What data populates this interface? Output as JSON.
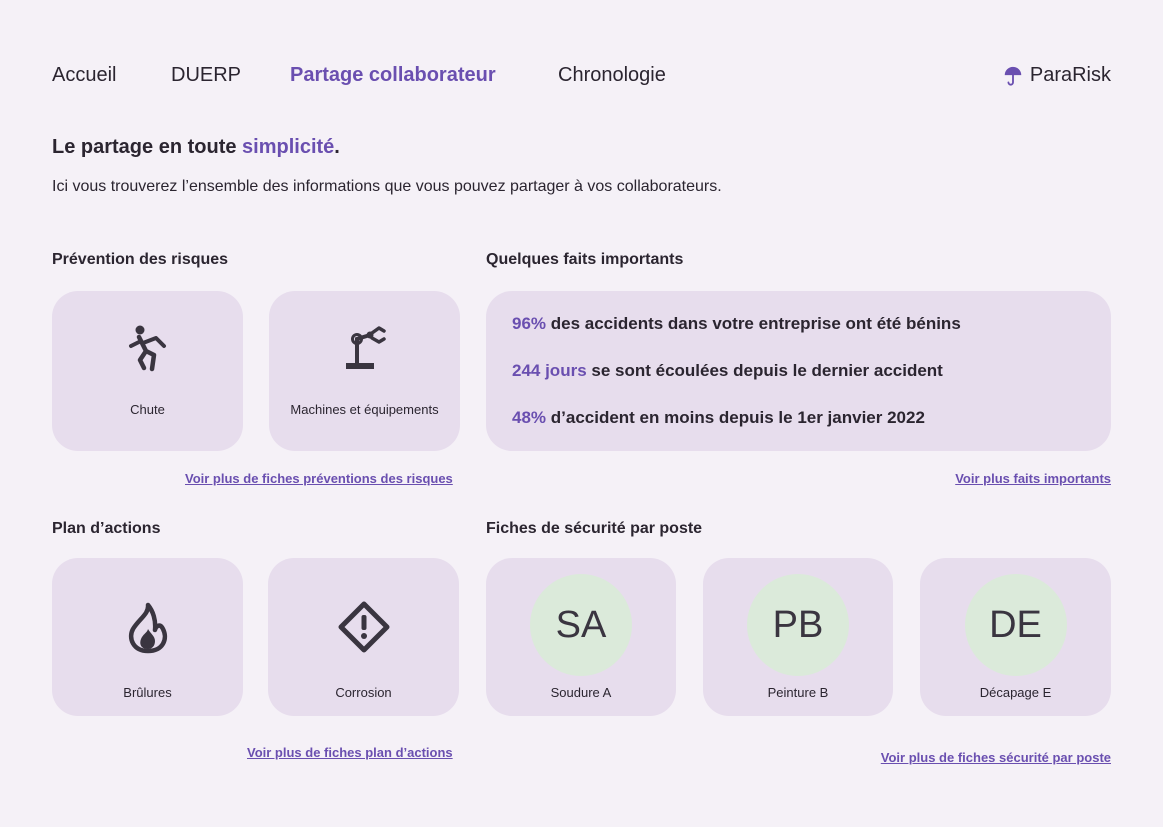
{
  "nav": {
    "items": [
      {
        "label": "Accueil"
      },
      {
        "label": "DUERP"
      },
      {
        "label": "Partage collaborateur"
      },
      {
        "label": "Chronologie"
      }
    ],
    "brand": "ParaRisk"
  },
  "headline": {
    "prefix": "Le partage en toute ",
    "accent": "simplicité",
    "suffix": "."
  },
  "intro": "Ici vous trouverez l’ensemble des informations que vous pouvez partager à vos collaborateurs.",
  "prevention": {
    "title": "Prévention des risques",
    "cards": [
      {
        "label": "Chute",
        "icon": "falling-person-icon"
      },
      {
        "label": "Machines et équipements",
        "icon": "robot-arm-icon"
      }
    ],
    "more": "Voir plus de fiches préventions des risques"
  },
  "facts": {
    "title": "Quelques faits importants",
    "items": [
      {
        "highlight": "96%",
        "text": " des accidents dans votre entreprise ont été bénins"
      },
      {
        "highlight": "244 jours",
        "text": " se sont écoulées depuis le dernier accident"
      },
      {
        "highlight": "48%",
        "text": " d’accident en moins depuis le 1er janvier 2022"
      }
    ],
    "more": "Voir plus faits importants"
  },
  "actions": {
    "title": "Plan d’actions",
    "cards": [
      {
        "label": "Brûlures",
        "icon": "fire-icon"
      },
      {
        "label": "Corrosion",
        "icon": "warning-diamond-icon"
      }
    ],
    "more": "Voir plus de fiches plan d’actions"
  },
  "safety": {
    "title": "Fiches de sécurité par poste",
    "cards": [
      {
        "initials": "SA",
        "label": "Soudure A"
      },
      {
        "initials": "PB",
        "label": "Peinture B"
      },
      {
        "initials": "DE",
        "label": "Décapage E"
      }
    ],
    "more": "Voir plus de fiches sécurité par poste"
  },
  "colors": {
    "background": "#f5f1f7",
    "card": "#e7dded",
    "accent": "#6a4fb0",
    "avatar": "#dbeada"
  }
}
